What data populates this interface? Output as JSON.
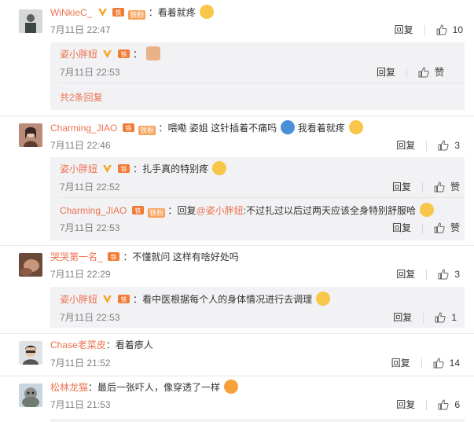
{
  "ui": {
    "reply_label": "回复",
    "like_label": "赞",
    "accent": "#eb7350"
  },
  "comments": [
    {
      "user": "WiNkieC_",
      "text": "看着就疼",
      "time": "7月11日 22:47",
      "likes": "10",
      "replies": [
        {
          "user": "姿小胖妞",
          "text": "",
          "time": "7月11日 22:53",
          "likes": "赞"
        }
      ],
      "more": "共2条回复"
    },
    {
      "user": "Charming_JIAO",
      "fan_badge": "铁粉",
      "text": "喂嘞 姿姐 这针插着不痛吗",
      "text2": "我看着就疼",
      "time": "7月11日 22:46",
      "likes": "3",
      "replies": [
        {
          "user": "姿小胖妞",
          "text": "扎手真的特别疼",
          "time": "7月11日 22:52",
          "likes": "赞"
        },
        {
          "user": "Charming_JIAO",
          "fan_badge": "铁粉",
          "text_prefix": "回复",
          "mention": "@姿小胖妞",
          "text": ":不过扎过以后过两天应该全身特别舒服哈",
          "time": "7月11日 22:53",
          "likes": "赞"
        }
      ]
    },
    {
      "user": "哭哭第一名_",
      "text": "不懂就问 这样有啥好处吗",
      "time": "7月11日 22:29",
      "likes": "3",
      "replies": [
        {
          "user": "姿小胖妞",
          "text": "看中医根据每个人的身体情况进行去调理",
          "time": "7月11日 22:53",
          "likes": "1"
        }
      ]
    },
    {
      "user": "Chase老菜皮",
      "text": "看着瘆人",
      "time": "7月11日 21:52",
      "likes": "14"
    },
    {
      "user": "松林龙猫",
      "text": "最后一张吓人，像穿透了一样",
      "time": "7月11日 21:53",
      "likes": "6"
    }
  ]
}
